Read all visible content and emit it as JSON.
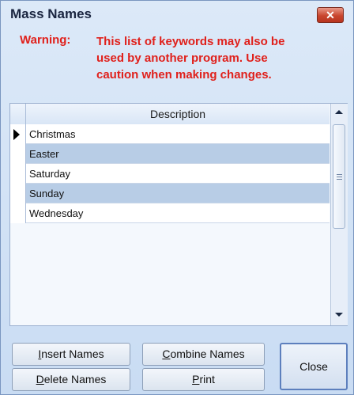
{
  "window": {
    "title": "Mass Names",
    "close_glyph": "✕"
  },
  "warning": {
    "label": "Warning:",
    "lines": [
      "This list of keywords may also be",
      "used by another program. Use",
      "caution when making changes."
    ]
  },
  "grid": {
    "column_header": "Description",
    "rows": [
      "Christmas",
      "Easter",
      "Saturday",
      "Sunday",
      "Wednesday"
    ]
  },
  "buttons": {
    "insert": {
      "first": "I",
      "rest": "nsert Names"
    },
    "combine": {
      "first": "C",
      "rest": "ombine Names"
    },
    "delete": {
      "first": "D",
      "rest": "elete Names"
    },
    "print": {
      "first": "P",
      "rest": "rint"
    },
    "close": "Close"
  }
}
